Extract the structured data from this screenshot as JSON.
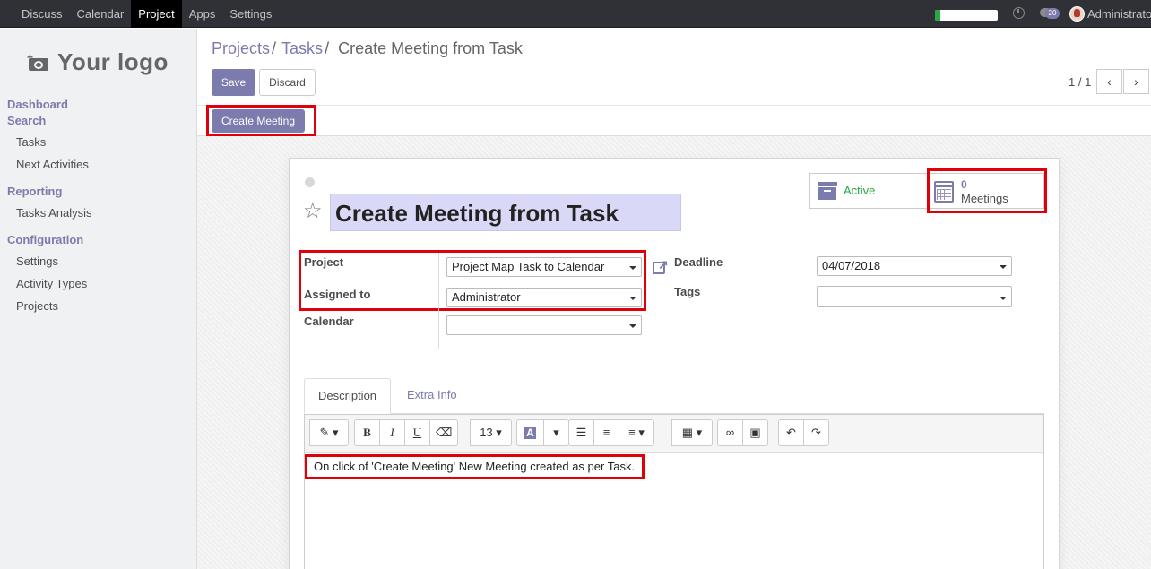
{
  "topbar": {
    "menu": [
      {
        "label": "Discuss",
        "active": false
      },
      {
        "label": "Calendar",
        "active": false
      },
      {
        "label": "Project",
        "active": true
      },
      {
        "label": "Apps",
        "active": false
      },
      {
        "label": "Settings",
        "active": false
      }
    ],
    "chat_count": "20",
    "user_name": "Administrator",
    "progress_fraction": 0.08
  },
  "sidebar": {
    "logo_text": "Your logo",
    "sections": [
      {
        "title": "Dashboard",
        "items": []
      },
      {
        "title": "Search",
        "items": [
          "Tasks",
          "Next Activities"
        ]
      },
      {
        "title": "Reporting",
        "items": [
          "Tasks Analysis"
        ]
      },
      {
        "title": "Configuration",
        "items": [
          "Settings",
          "Activity Types",
          "Projects"
        ]
      }
    ]
  },
  "breadcrumb": {
    "items": [
      "Projects",
      "Tasks"
    ],
    "current": "Create Meeting from Task"
  },
  "buttons": {
    "save": "Save",
    "discard": "Discard",
    "create_meeting": "Create Meeting"
  },
  "pager": {
    "value": "1 / 1",
    "prev": "‹",
    "next": "›"
  },
  "form": {
    "title": "Create Meeting from Task",
    "status": "Active",
    "meetings_count": "0",
    "meetings_label": "Meetings",
    "fields": {
      "project_label": "Project",
      "project_value": "Project Map Task to Calendar",
      "assigned_label": "Assigned to",
      "assigned_value": "Administrator",
      "calendar_label": "Calendar",
      "calendar_value": "",
      "deadline_label": "Deadline",
      "deadline_value": "04/07/2018",
      "tags_label": "Tags",
      "tags_value": ""
    },
    "tabs": [
      "Description",
      "Extra Info"
    ],
    "toolbar": {
      "font_size": "13",
      "bold": "B",
      "italic": "I",
      "underline": "U",
      "color_letter": "A"
    },
    "description": "On click of 'Create Meeting' New Meeting created as per Task."
  },
  "colors": {
    "accent": "#7c7bad",
    "highlight": "#e0000a",
    "active_status": "#28a745",
    "navbar": "#2f3136"
  }
}
